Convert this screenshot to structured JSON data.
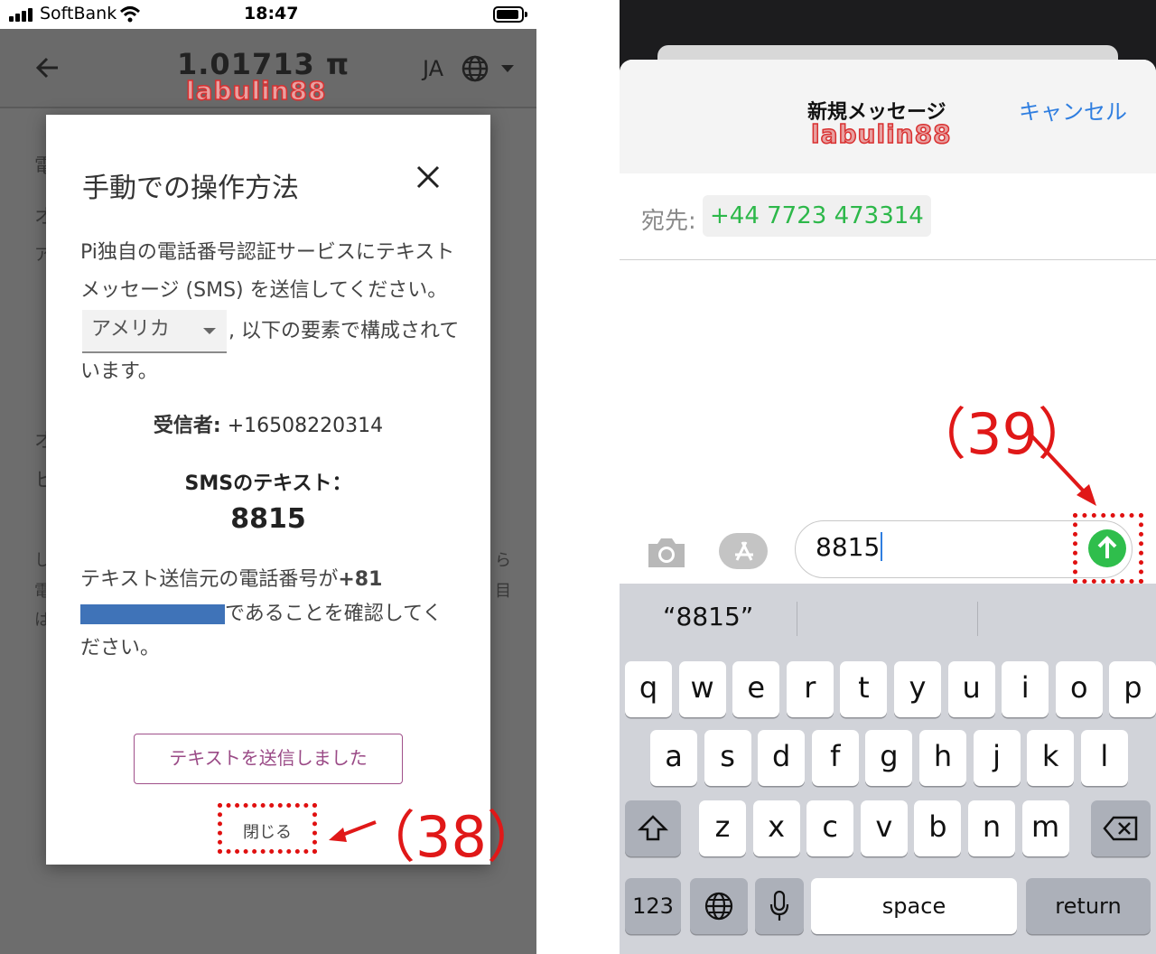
{
  "left": {
    "status": {
      "carrier": "SoftBank",
      "time": "18:47"
    },
    "appbar": {
      "balance": "1.01713 π",
      "lang": "JA"
    },
    "watermark": "labulin88",
    "bg_fragments": [
      "電",
      "オ",
      "ア",
      "オ",
      "ヒ",
      "し",
      "電",
      "は",
      "ら",
      "目"
    ],
    "modal": {
      "title": "手動での操作方法",
      "para_before": "Pi独自の電話番号認証サービスにテキストメッセージ (SMS) を送信してください。",
      "country_select": "アメリカ",
      "para_after": ", 以下の要素で構成されています。",
      "recipient_label": "受信者:",
      "recipient_value": " +16508220314",
      "sms_label": "SMSのテキスト：",
      "sms_code": "8815",
      "confirm_before": "テキスト送信元の電話番号が",
      "confirm_prefix": "+81",
      "confirm_after": "であることを確認してください。",
      "sent_button": "テキストを送信しました",
      "close_button": "閉じる"
    },
    "annotation": "（38）"
  },
  "right": {
    "nav": {
      "title": "新規メッセージ",
      "cancel": "キャンセル"
    },
    "watermark": "labulin88",
    "to_label": "宛先:",
    "to_value": "+44 7723 473314",
    "input_value": "8815",
    "annotation": "（39）",
    "suggestion": "“8815”",
    "keyboard": {
      "row1": [
        "q",
        "w",
        "e",
        "r",
        "t",
        "y",
        "u",
        "i",
        "o",
        "p"
      ],
      "row2": [
        "a",
        "s",
        "d",
        "f",
        "g",
        "h",
        "j",
        "k",
        "l"
      ],
      "row3": [
        "z",
        "x",
        "c",
        "v",
        "b",
        "n",
        "m"
      ],
      "numbers": "123",
      "space": "space",
      "return": "return"
    }
  },
  "colors": {
    "annotation_red": "#e01818",
    "send_green": "#2fbe4c",
    "ios_blue": "#2f7ee0",
    "recipient_green": "#2db84a"
  },
  "icons": [
    "signal-icon",
    "wifi-icon",
    "battery-icon",
    "back-arrow-icon",
    "globe-icon",
    "close-icon",
    "camera-icon",
    "app-store-icon",
    "send-arrow-icon",
    "shift-icon",
    "delete-icon",
    "globe-keyboard-icon",
    "microphone-icon"
  ]
}
